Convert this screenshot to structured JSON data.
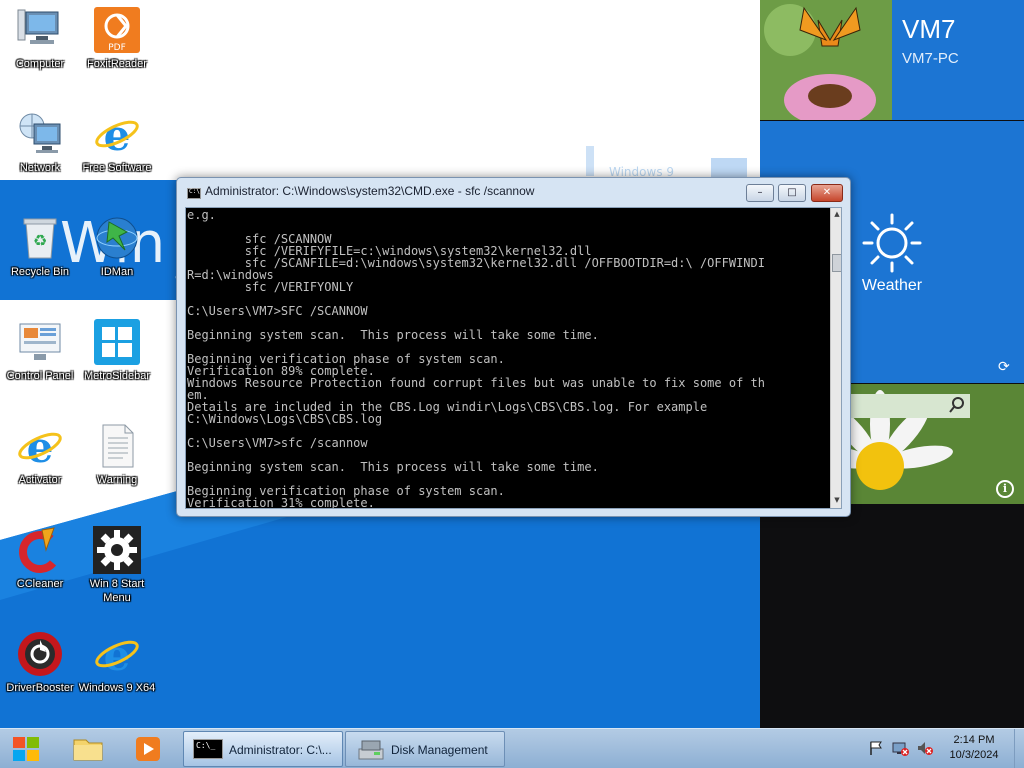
{
  "desktop": {
    "icons": [
      {
        "label": "Computer",
        "icon": "computer-icon"
      },
      {
        "label": "FoxitReader",
        "icon": "pdf-reader-icon",
        "badge": "PDF"
      },
      {
        "label": "Network",
        "icon": "network-icon"
      },
      {
        "label": "Free Software",
        "icon": "internet-explorer-icon"
      },
      {
        "label": "Recycle Bin",
        "icon": "recycle-bin-icon"
      },
      {
        "label": "IDMan",
        "icon": "download-manager-icon"
      },
      {
        "label": "Control Panel",
        "icon": "control-panel-icon"
      },
      {
        "label": "MetroSidebar",
        "icon": "metro-sidebar-icon"
      },
      {
        "label": "Activator",
        "icon": "internet-explorer-icon"
      },
      {
        "label": "Warning",
        "icon": "text-file-icon"
      },
      {
        "label": "CCleaner",
        "icon": "ccleaner-icon"
      },
      {
        "label": "Win 8 Start Menu",
        "icon": "gear-icon"
      },
      {
        "label": "DriverBooster",
        "icon": "driver-booster-icon"
      },
      {
        "label": "Windows 9 X64",
        "icon": "internet-explorer-icon"
      }
    ]
  },
  "tiles": {
    "user": {
      "name": "VM7",
      "computer": "VM7-PC"
    },
    "weather": {
      "label": "Weather"
    }
  },
  "cmd": {
    "title": "Administrator: C:\\Windows\\system32\\CMD.exe - sfc  /scannow",
    "icon_text": "C:\\",
    "buttons": {
      "minimize": "–",
      "maximize": "□",
      "close": "✕"
    },
    "lines": [
      "e.g.",
      "",
      "        sfc /SCANNOW",
      "        sfc /VERIFYFILE=c:\\windows\\system32\\kernel32.dll",
      "        sfc /SCANFILE=d:\\windows\\system32\\kernel32.dll /OFFBOOTDIR=d:\\ /OFFWINDI",
      "R=d:\\windows",
      "        sfc /VERIFYONLY",
      "",
      "C:\\Users\\VM7>SFC /SCANNOW",
      "",
      "Beginning system scan.  This process will take some time.",
      "",
      "Beginning verification phase of system scan.",
      "Verification 89% complete.",
      "Windows Resource Protection found corrupt files but was unable to fix some of th",
      "em.",
      "Details are included in the CBS.Log windir\\Logs\\CBS\\CBS.log. For example",
      "C:\\Windows\\Logs\\CBS\\CBS.log",
      "",
      "C:\\Users\\VM7>sfc /scannow",
      "",
      "Beginning system scan.  This process will take some time.",
      "",
      "Beginning verification phase of system scan.",
      "Verification 31% complete."
    ]
  },
  "taskbar": {
    "pinned": [
      "windows-logo-icon",
      "file-explorer-icon",
      "media-player-icon"
    ],
    "tasks": [
      {
        "label": "Administrator: C:\\...",
        "icon": "command-prompt-icon",
        "icon_text": "C:\\_",
        "active": true
      },
      {
        "label": "Disk Management",
        "icon": "disk-management-icon",
        "active": false
      }
    ],
    "tray": {
      "time": "2:14 PM",
      "date": "10/3/2024"
    }
  },
  "colors": {
    "accent_blue": "#1173d4",
    "tile_blue": "#1c75d3",
    "taskbar": "#a4c1e0",
    "console_bg": "#000000",
    "console_text": "#c0c0c0"
  }
}
